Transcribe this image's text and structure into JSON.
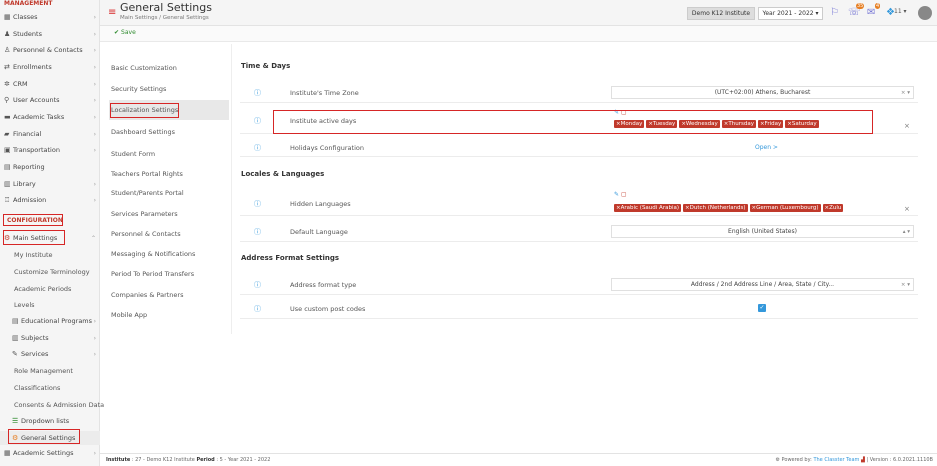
{
  "sidebar": {
    "management_header": "MANAGEMENT",
    "configuration_header": "CONFIGURATION",
    "items": [
      {
        "label": "Classes",
        "icon": "classes-icon"
      },
      {
        "label": "Students",
        "icon": "students-icon"
      },
      {
        "label": "Personnel & Contacts",
        "icon": "personnel-icon"
      },
      {
        "label": "Enrollments",
        "icon": "enrollments-icon"
      },
      {
        "label": "CRM",
        "icon": "crm-icon"
      },
      {
        "label": "User Accounts",
        "icon": "user-accounts-icon"
      },
      {
        "label": "Academic Tasks",
        "icon": "academic-tasks-icon"
      },
      {
        "label": "Financial",
        "icon": "financial-icon"
      },
      {
        "label": "Transportation",
        "icon": "transportation-icon"
      },
      {
        "label": "Reporting",
        "icon": "reporting-icon"
      },
      {
        "label": "Library",
        "icon": "library-icon"
      },
      {
        "label": "Admission",
        "icon": "admission-icon"
      }
    ],
    "main_settings": "Main Settings",
    "sub_items": [
      "My Institute",
      "Customize Terminology",
      "Academic Periods",
      "Levels",
      "Educational Programs",
      "Subjects",
      "Services",
      "Role Management",
      "Classifications",
      "Consents & Admission Data",
      "Dropdown lists",
      "General Settings"
    ],
    "academic_settings": "Academic Settings"
  },
  "header": {
    "title": "General Settings",
    "breadcrumb": "Main Settings / General Settings",
    "institute": "Demo K12 Institute",
    "year": "Year 2021 - 2022 ▾",
    "badge_1": "35",
    "badge_2": "4",
    "counter": "11 ▾"
  },
  "toolbar": {
    "save_label": "Save"
  },
  "left_menu": [
    "Basic Customization",
    "Security Settings",
    "Localization Settings",
    "Dashboard Settings",
    "Student Form",
    "Teachers Portal Rights",
    "Student/Parents Portal",
    "Services Parameters",
    "Personnel & Contacts",
    "Messaging & Notifications",
    "Period To Period Transfers",
    "Companies & Partners",
    "Mobile App"
  ],
  "sections": {
    "time_days": {
      "title": "Time & Days",
      "timezone_label": "Institute's Time Zone",
      "timezone_value": "(UTC+02:00) Athens, Bucharest",
      "active_days_label": "Institute active days",
      "active_days": [
        "×Monday",
        "×Tuesday",
        "×Wednesday",
        "×Thursday",
        "×Friday",
        "×Saturday"
      ],
      "holidays_label": "Holidays Configuration",
      "holidays_value": "Open >"
    },
    "locales": {
      "title": "Locales & Languages",
      "hidden_label": "Hidden Languages",
      "hidden_languages": [
        "×Arabic (Saudi Arabia)",
        "×Dutch (Netherlands)",
        "×German (Luxembourg)",
        "×Zulu"
      ],
      "default_label": "Default Language",
      "default_value": "English (United States)"
    },
    "address": {
      "title": "Address Format Settings",
      "format_label": "Address format type",
      "format_value": "Address / 2nd Address Line / Area, State / City...",
      "postcode_label": "Use custom post codes"
    }
  },
  "footer": {
    "institute_label": "Institute",
    "institute_value": ": 27 - Demo K12 Institute",
    "period_label": "Period",
    "period_value": ": 5 - Year 2021 - 2022",
    "powered_by": "Powered by:",
    "team": "The Classter Team",
    "version": "| Version : 6.0.2021.1110B"
  }
}
